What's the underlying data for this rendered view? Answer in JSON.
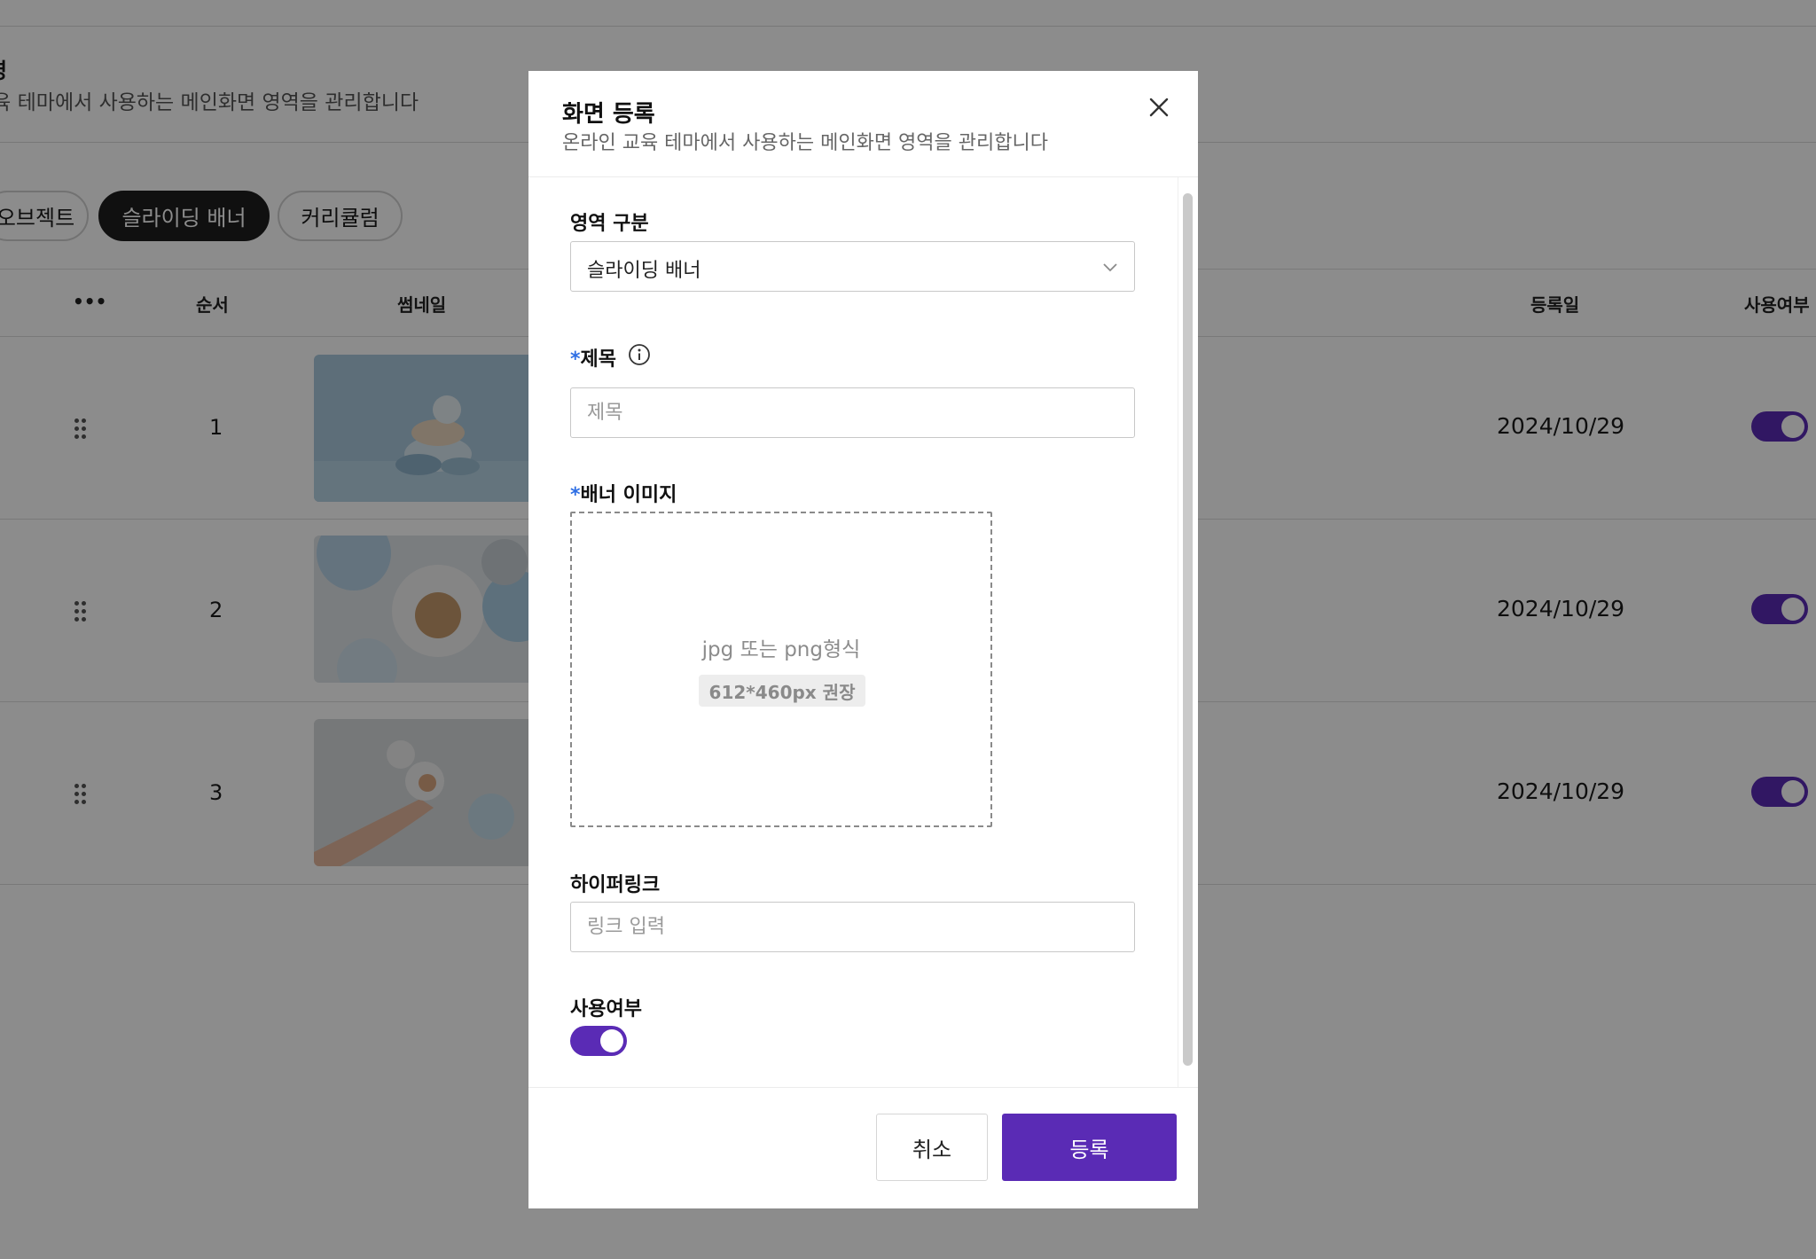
{
  "background": {
    "page_title": "영",
    "page_subtitle": "교육 테마에서 사용하는 메인화면 영역을 관리합니다",
    "chips": [
      "오브젝트",
      "슬라이딩 배너",
      "커리큘럼"
    ],
    "active_chip": "슬라이딩 배너",
    "table": {
      "headers": {
        "more": "•••",
        "order": "순서",
        "thumbnail": "썸네일",
        "registered": "등록일",
        "use": "사용여부"
      },
      "rows": [
        {
          "order": "1",
          "date": "2024/10/29",
          "enabled": true
        },
        {
          "order": "2",
          "date": "2024/10/29",
          "enabled": true
        },
        {
          "order": "3",
          "date": "2024/10/29",
          "enabled": true
        }
      ]
    }
  },
  "modal": {
    "title": "화면 등록",
    "description": "온라인 교육 테마에서 사용하는 메인화면 영역을 관리합니다",
    "area_label": "영역 구분",
    "area_value": "슬라이딩 배너",
    "required_mark": "*",
    "title_label": "제목",
    "title_placeholder": "제목",
    "banner_label": "배너 이미지",
    "upload_format": "jpg 또는 png형식",
    "upload_size": "612*460px 권장",
    "link_label": "하이퍼링크",
    "link_placeholder": "링크 입력",
    "use_label": "사용여부",
    "use_enabled": true,
    "cancel_label": "취소",
    "submit_label": "등록"
  },
  "colors": {
    "accent": "#5a2bb5",
    "required": "#2f6fe4",
    "overlay": "rgba(0,0,0,0.45)"
  }
}
